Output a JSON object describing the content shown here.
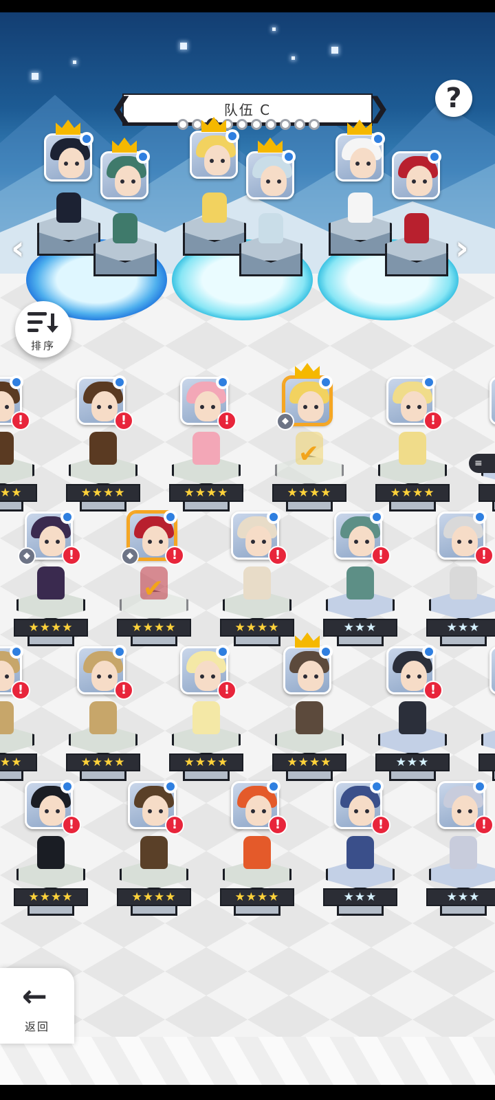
{
  "team": {
    "title": "队伍 C",
    "page_count": 10,
    "active_page": 2
  },
  "buttons": {
    "help": "?",
    "sort": "排序",
    "back": "返回",
    "side_tag": "≡"
  },
  "icons": {
    "prev": "prev-arrow-icon",
    "next": "next-arrow-icon",
    "sort": "sort-icon",
    "back": "back-arrow-icon"
  },
  "colors": {
    "accent_gold": "#f5a623",
    "badge_red": "#e8253b",
    "badge_blue": "#2f7fe0",
    "sky": "#1d5b94"
  },
  "team_slots": [
    {
      "hair": "#1c2233",
      "crown": true
    },
    {
      "hair": "#3f7a6b",
      "crown": true
    },
    {
      "hair": "#f2d25f",
      "crown": true
    },
    {
      "hair": "#c9dde8",
      "crown": true
    },
    {
      "hair": "#f5f5f5",
      "crown": true
    },
    {
      "hair": "#b8202e",
      "crown": false
    }
  ],
  "roster": [
    [
      {
        "hair": "#5a3a22",
        "stars": "★★★★",
        "alert": true,
        "blue": false
      },
      {
        "hair": "#f3a7b7",
        "stars": "★★★★",
        "alert": true,
        "blue": false
      },
      {
        "hair": "#f2d25f",
        "stars": "★★★★",
        "alert": false,
        "blue": false,
        "selected": true,
        "crown": true,
        "check": true,
        "gem": true
      },
      {
        "hair": "#f0dc8a",
        "stars": "★★★★",
        "alert": true,
        "blue": false
      },
      {
        "hair": "#2fa0b8",
        "stars": "★★★",
        "alert": true,
        "blue": true
      }
    ],
    [
      {
        "hair": "#3a2a4f",
        "stars": "★★★★",
        "alert": true,
        "blue": false,
        "gem": true
      },
      {
        "hair": "#b8202e",
        "stars": "★★★★",
        "alert": true,
        "blue": false,
        "selected": true,
        "check": true,
        "gem": true
      },
      {
        "hair": "#e8dcc8",
        "stars": "★★★★",
        "alert": true,
        "blue": false
      },
      {
        "hair": "#5d8f86",
        "stars": "★★★",
        "alert": true,
        "blue": true
      },
      {
        "hair": "#d9d9d9",
        "stars": "★★★",
        "alert": true,
        "blue": true
      }
    ],
    [
      {
        "hair": "#c7a66a",
        "stars": "★★★★",
        "alert": true,
        "blue": false
      },
      {
        "hair": "#f4e8a6",
        "stars": "★★★★",
        "alert": true,
        "blue": false
      },
      {
        "hair": "#5c4a3c",
        "stars": "★★★★",
        "alert": false,
        "blue": false,
        "crown": true
      },
      {
        "hair": "#2b2f3a",
        "stars": "★★★",
        "alert": true,
        "blue": true
      },
      {
        "hair": "#f2d25f",
        "stars": "★★★",
        "alert": true,
        "blue": true
      }
    ],
    [
      {
        "hair": "#1a1d24",
        "stars": "★★★★",
        "alert": true,
        "blue": false
      },
      {
        "hair": "#5a4028",
        "stars": "★★★★",
        "alert": true,
        "blue": false
      },
      {
        "hair": "#e45a2a",
        "stars": "★★★★",
        "alert": true,
        "blue": false
      },
      {
        "hair": "#3a4f8a",
        "stars": "★★★",
        "alert": true,
        "blue": true
      },
      {
        "hair": "#c8ccdc",
        "stars": "★★★",
        "alert": true,
        "blue": true
      }
    ]
  ]
}
